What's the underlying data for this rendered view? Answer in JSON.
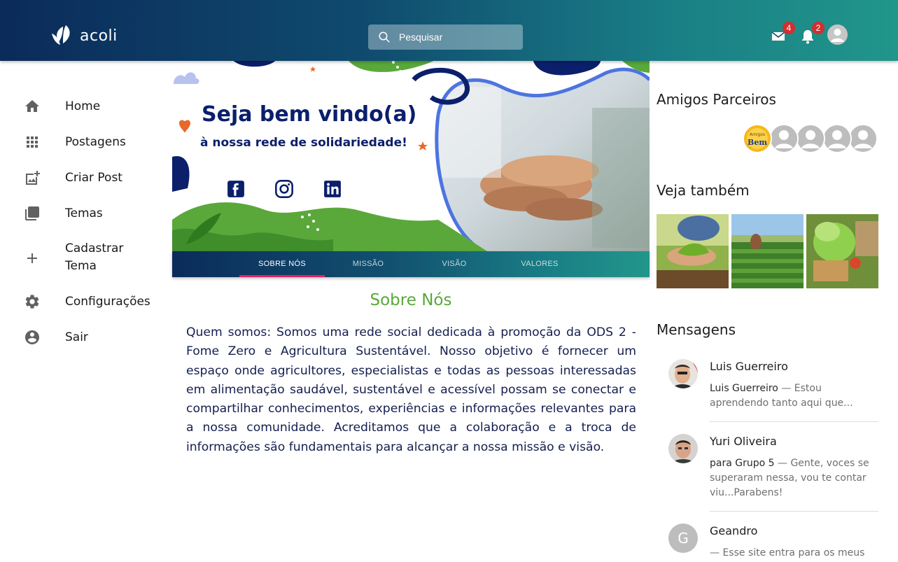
{
  "app": {
    "name": "acoli"
  },
  "header": {
    "search": {
      "placeholder": "Pesquisar"
    },
    "mail_badge": "4",
    "notifications_badge": "2"
  },
  "sidebar": {
    "items": [
      {
        "label": "Home",
        "icon": "home-icon"
      },
      {
        "label": "Postagens",
        "icon": "apps-grid-icon"
      },
      {
        "label": "Criar Post",
        "icon": "add-photo-icon"
      },
      {
        "label": "Temas",
        "icon": "library-icon"
      },
      {
        "label": "Cadastrar Tema",
        "icon": "plus-icon"
      },
      {
        "label": "Configurações",
        "icon": "gear-icon"
      },
      {
        "label": "Sair",
        "icon": "account-circle-icon"
      }
    ]
  },
  "banner": {
    "headline": "Seja bem vindo(a)",
    "subheadline": "à nossa rede de solidariedade!",
    "tabs": [
      {
        "label": "SOBRE NÓS",
        "active": true
      },
      {
        "label": "MISSÃO",
        "active": false
      },
      {
        "label": "VISÃO",
        "active": false
      },
      {
        "label": "VALORES",
        "active": false
      }
    ]
  },
  "about": {
    "title": "Sobre Nós",
    "text": "Quem somos: Somos uma rede social dedicada à promoção da ODS 2 - Fome Zero e Agricultura Sustentável. Nosso objetivo é fornecer um espaço onde agricultores, especialistas e todas as pessoas interessadas em alimentação saudável, sustentável e acessível possam se conectar e compartilhar conhecimentos, experiências e informações relevantes para a nossa comunidade. Acreditamos que a colaboração e a troca de informações são fundamentais para alcançar a nossa missão e visão."
  },
  "right": {
    "partners_title": "Amigos Parceiros",
    "partner_logo_text": "Amigos do Bem",
    "see_also_title": "Veja também",
    "messages_title": "Mensagens",
    "messages": [
      {
        "name": "Luis Guerreiro",
        "from": "Luis Guerreiro",
        "preview": " — Estou aprendendo tanto aqui que..."
      },
      {
        "name": "Yuri Oliveira",
        "from": "para Grupo 5",
        "preview": " — Gente, voces se superaram nessa, vou te contar viu...Parabens!"
      },
      {
        "name": "Geandro",
        "from": "",
        "preview": "— Esse site entra para os meus",
        "initial": "G"
      }
    ]
  },
  "colors": {
    "accent_green": "#5aa83a",
    "tab_indicator": "#e91e63",
    "badge": "#d32f2f",
    "text_navy": "#141e4f"
  }
}
